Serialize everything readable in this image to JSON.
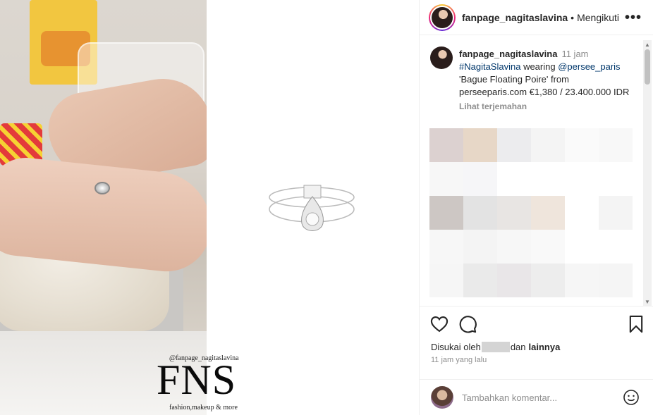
{
  "header": {
    "username": "fanpage_nagitaslavina",
    "separator": "•",
    "follow_status": "Mengikuti",
    "more_icon": "more-horizontal-icon"
  },
  "caption": {
    "username": "fanpage_nagitaslavina",
    "time": "11 jam",
    "hashtag": "#NagitaSlavina",
    "text_1": " wearing ",
    "mention": "@persee_paris",
    "text_2": " 'Bague Floating Poire' from perseeparis.com €1,380 / 23.400.000 IDR",
    "translate": "Lihat terjemahan"
  },
  "watermark": {
    "handle": "@fanpage_nagitaslavina",
    "logo": "FNS",
    "tagline": "fashion,makeup & more"
  },
  "likes": {
    "prefix": "Disukai oleh",
    "suffix": "dan",
    "others": "lainnya"
  },
  "timestamp": "11 jam yang lalu",
  "comment_box": {
    "placeholder": "Tambahkan komentar..."
  },
  "pixel_colors": [
    "#dcd1d0",
    "#e7d7c7",
    "#ececee",
    "#f4f4f4",
    "#fafafa",
    "#f8f8f8",
    "#f7f7f7",
    "#f6f6f8",
    "#ffffff",
    "#ffffff",
    "#ffffff",
    "#ffffff",
    "#cdc7c4",
    "#e3e3e3",
    "#e8e5e3",
    "#efe5dc",
    "#ffffff",
    "#f4f4f4",
    "#f7f7f7",
    "#f4f4f4",
    "#f7f7f7",
    "#f9f9f9",
    "#ffffff",
    "#ffffff",
    "#f6f6f6",
    "#eaeaea",
    "#e9e6e8",
    "#ededed",
    "#f6f6f6",
    "#f5f5f5"
  ]
}
